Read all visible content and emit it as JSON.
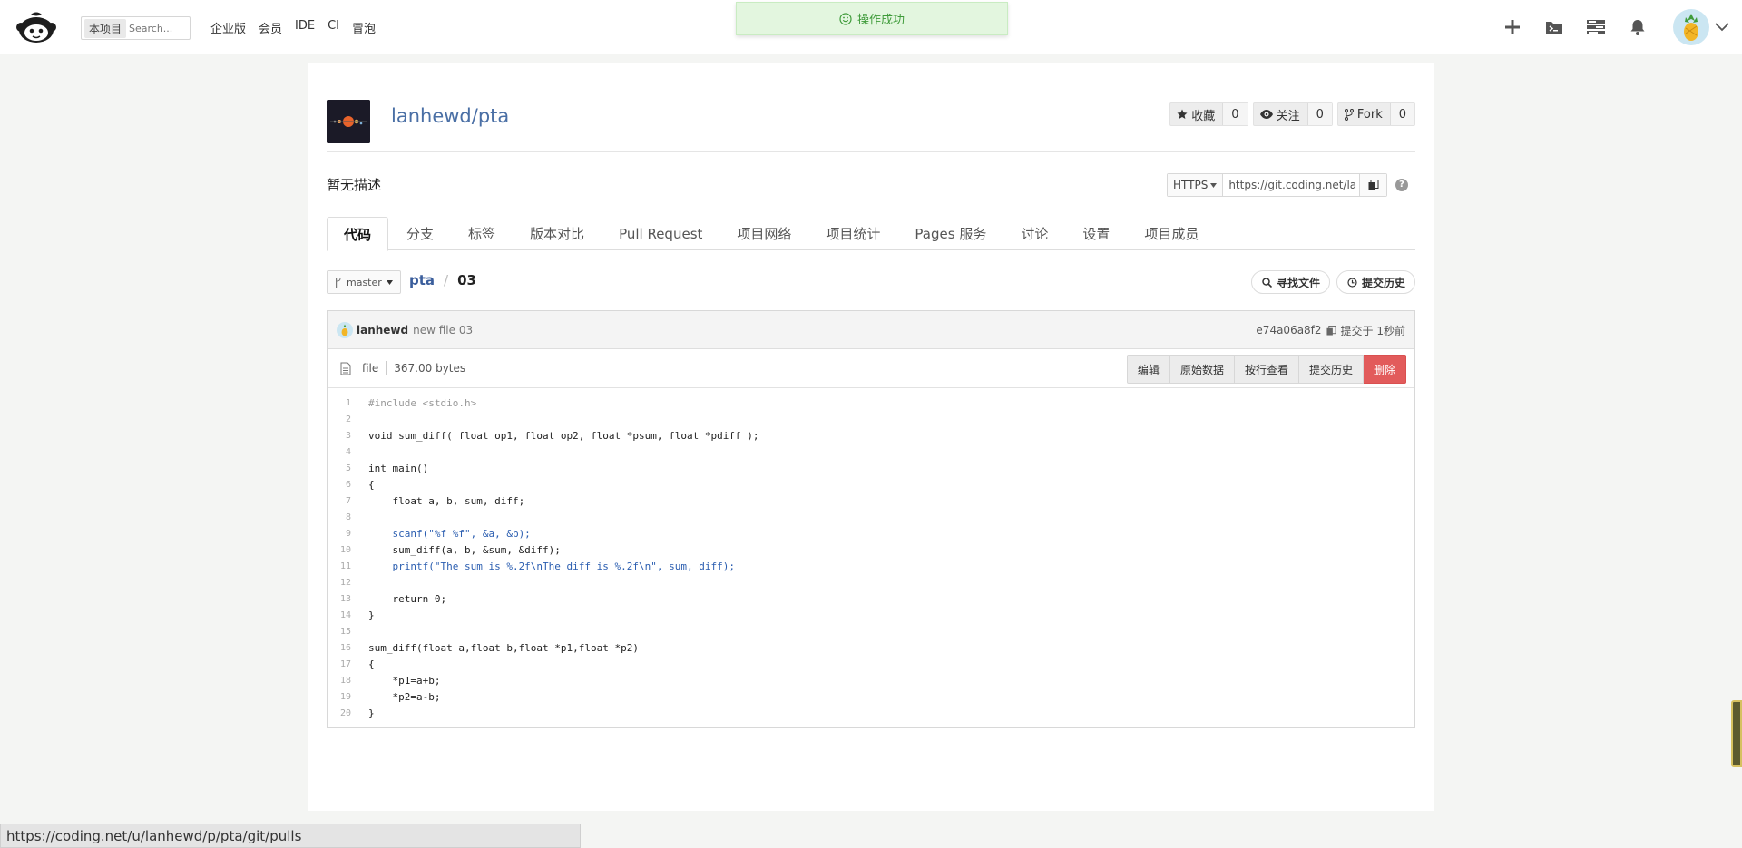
{
  "topbar": {
    "search_scope": "本项目",
    "search_placeholder": "Search...",
    "nav": [
      "企业版",
      "会员",
      "IDE",
      "CI",
      "冒泡"
    ]
  },
  "toast": {
    "message": "操作成功"
  },
  "repo": {
    "full_name": "lanhewd/pta",
    "star_label": "收藏",
    "star_count": "0",
    "watch_label": "关注",
    "watch_count": "0",
    "fork_label": "Fork",
    "fork_count": "0",
    "description": "暂无描述",
    "clone_protocol": "HTTPS",
    "clone_url": "https://git.coding.net/la"
  },
  "tabs": [
    "代码",
    "分支",
    "标签",
    "版本对比",
    "Pull Request",
    "项目网络",
    "项目统计",
    "Pages 服务",
    "讨论",
    "设置",
    "项目成员"
  ],
  "breadcrumb": {
    "branch": "master",
    "repo": "pta",
    "sep": "/",
    "file": "03"
  },
  "buttons": {
    "find_file": "寻找文件",
    "history": "提交历史"
  },
  "commit": {
    "author": "lanhewd",
    "message": "new file 03",
    "sha": "e74a06a8f2",
    "time": "提交于 1秒前"
  },
  "file": {
    "type": "file",
    "size": "367.00 bytes",
    "actions": [
      "编辑",
      "原始数据",
      "按行查看",
      "提交历史"
    ],
    "delete": "删除"
  },
  "code": {
    "lines": [
      "#include <stdio.h>",
      "",
      "void sum_diff( float op1, float op2, float *psum, float *pdiff );",
      "",
      "int main()",
      "{",
      "    float a, b, sum, diff;",
      "",
      "    scanf(\"%f %f\", &a, &b);",
      "    sum_diff(a, b, &sum, &diff);",
      "    printf(\"The sum is %.2f\\nThe diff is %.2f\\n\", sum, diff);",
      "",
      "    return 0;",
      "}",
      "",
      "sum_diff(float a,float b,float *p1,float *p2)",
      "{",
      "    *p1=a+b;",
      "    *p2=a-b;",
      "}"
    ]
  },
  "status_url": "https://coding.net/u/lanhewd/p/pta/git/pulls"
}
